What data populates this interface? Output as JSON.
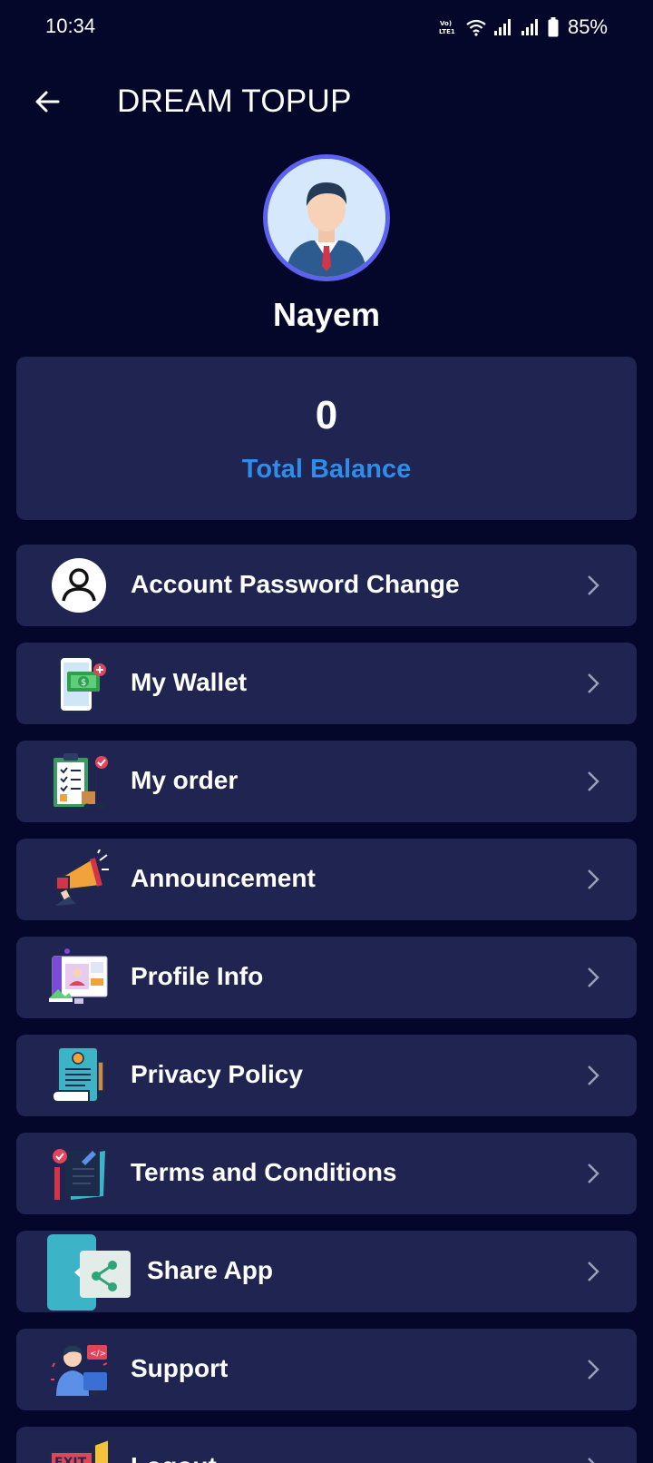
{
  "status_bar": {
    "time": "10:34",
    "network_label": "VoLTE1",
    "battery": "85%"
  },
  "header": {
    "title": "DREAM TOPUP",
    "back_icon": "arrow-left-icon"
  },
  "profile": {
    "name": "Nayem",
    "avatar_icon": "user-avatar-icon"
  },
  "balance": {
    "value": "0",
    "label": "Total Balance",
    "label_color": "#2f8ce8"
  },
  "menu": {
    "items": [
      {
        "label": "Account Password Change",
        "icon": "account-circle-icon"
      },
      {
        "label": "My Wallet",
        "icon": "wallet-phone-icon"
      },
      {
        "label": "My order",
        "icon": "order-clipboard-icon"
      },
      {
        "label": "Announcement",
        "icon": "megaphone-icon"
      },
      {
        "label": "Profile Info",
        "icon": "profile-screen-icon"
      },
      {
        "label": "Privacy Policy",
        "icon": "policy-document-icon"
      },
      {
        "label": "Terms and Conditions",
        "icon": "terms-checklist-icon"
      },
      {
        "label": "Share App",
        "icon": "share-icon"
      },
      {
        "label": "Support",
        "icon": "support-agent-icon"
      },
      {
        "label": "Logout",
        "icon": "exit-door-icon"
      }
    ]
  },
  "colors": {
    "background": "#04072a",
    "card": "#1f2450",
    "accent": "#2f8ce8",
    "avatar_ring": "#5b62f0"
  }
}
